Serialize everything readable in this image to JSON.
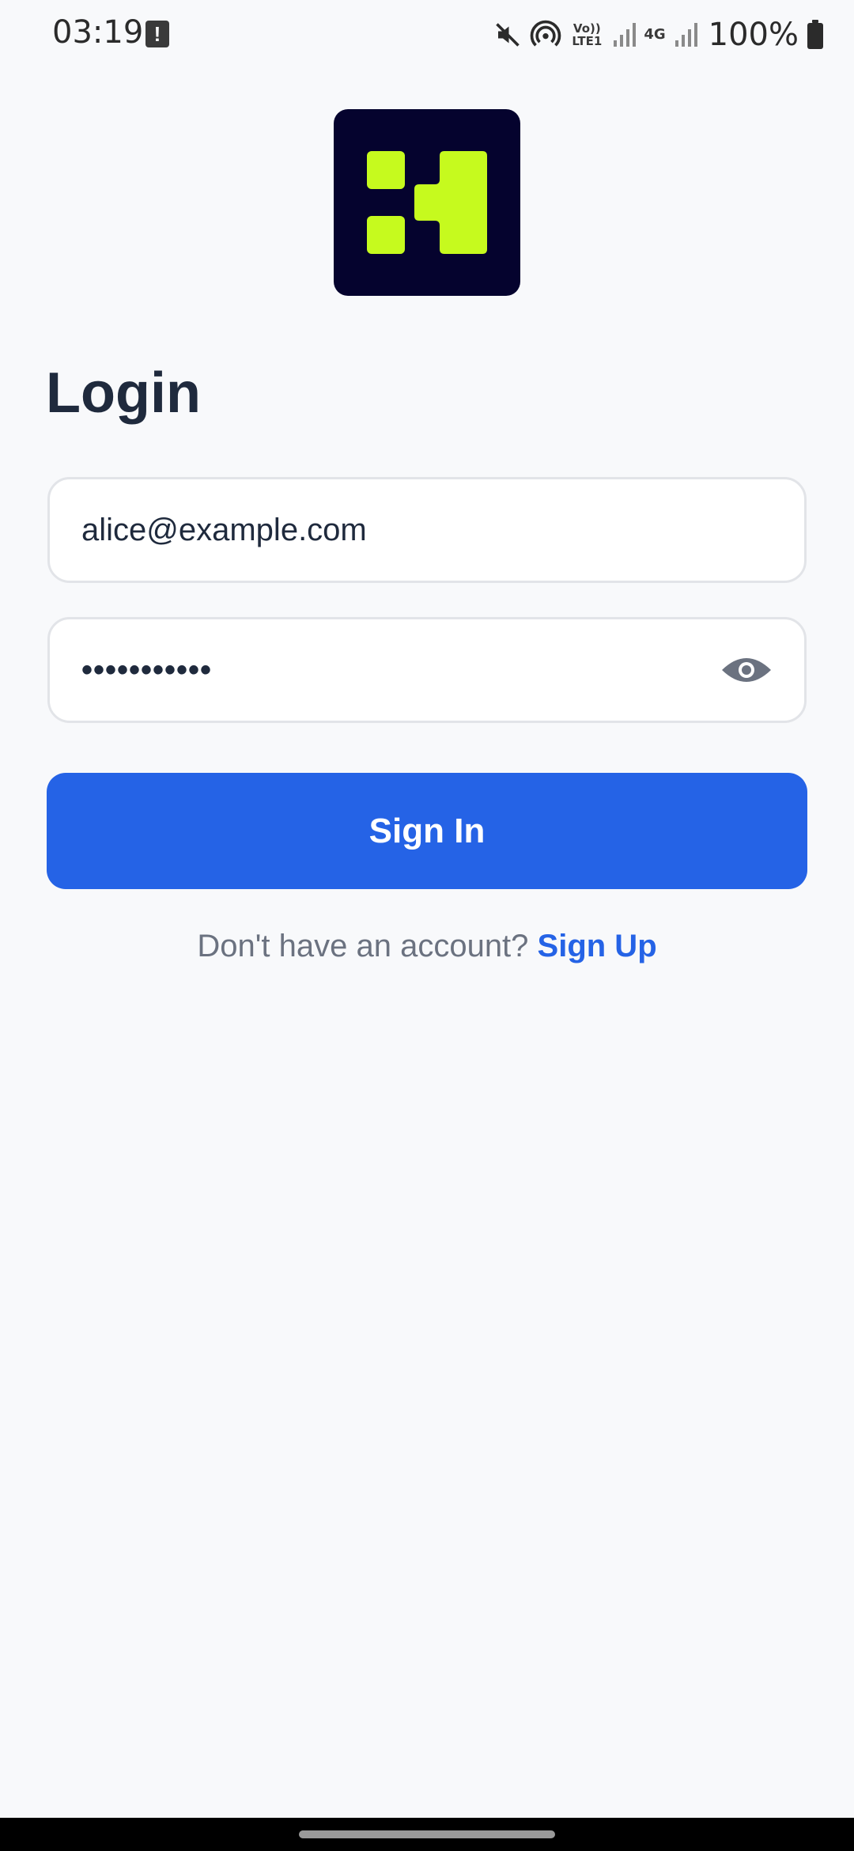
{
  "status_bar": {
    "time": "03:19",
    "alert_glyph": "!",
    "volte_label": "Vo)) LTE1",
    "network_label": "4G",
    "battery_percent": "100%",
    "icons": [
      "alert-icon",
      "mute-icon",
      "hotspot-icon",
      "volte-icon",
      "signal-icon",
      "network-4g-icon",
      "battery-icon"
    ]
  },
  "app": {
    "logo_icon": "app-logo-icon",
    "logo_colors": {
      "background": "#05032e",
      "mark": "#c6fa1e"
    }
  },
  "login": {
    "title": "Login",
    "email_value": "alice@example.com",
    "password_value": "•••••••••••",
    "password_toggle_icon": "eye-icon",
    "sign_in_label": "Sign In",
    "signup_prompt": "Don't have an account?",
    "signup_link": "Sign Up"
  },
  "colors": {
    "accent": "#2563e6",
    "title": "#1f2a3d",
    "muted": "#6b7280",
    "background": "#f8f9fb"
  }
}
